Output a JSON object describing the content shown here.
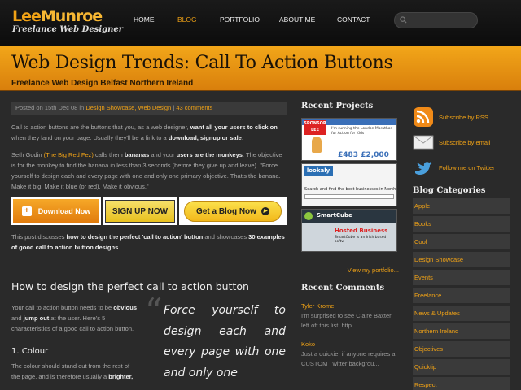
{
  "logo": {
    "name_a": "Lee",
    "name_b": "Munroe",
    "tagline": "Freelance Web Designer"
  },
  "nav": [
    "HOME",
    "BLOG",
    "PORTFOLIO",
    "ABOUT ME",
    "CONTACT"
  ],
  "nav_active": "BLOG",
  "search": {
    "placeholder": ""
  },
  "banner": {
    "title": "Web Design Trends: Call To Action Buttons",
    "subtitle": "Freelance Web Design Belfast Northern Ireland"
  },
  "post": {
    "meta": {
      "prefix": "Posted on 15th Dec 08 in ",
      "categories": "Design Showcase, Web Design",
      "separator": " | ",
      "comments": "43 comments"
    },
    "p1": {
      "a": "Call to action buttons are the buttons that you, as a web designer, ",
      "b": "want all your users to click on",
      "c": " when they land on your page. Usually they'll be a link to a ",
      "d": "download, signup or sale",
      "e": "."
    },
    "p2": {
      "a": "Seth Godin ",
      "link": "(The Big Red Fez)",
      "b": " calls them ",
      "c": "bananas",
      "d": " and your ",
      "e": "users are the monkeys",
      "f": ". The objective is for the monkey to find the banana in less than 3 seconds (before they give up and leave). \"Force yourself to design each and every page with one and only one primary objective. That's the banana. Make it big. Make it blue (or red). Make it obvious.\""
    },
    "cta": {
      "download": "Download Now",
      "signup": "SIGN UP NOW",
      "blog": "Get a Blog Now"
    },
    "p3": {
      "a": "This post discusses ",
      "b": "how to design the perfect 'call to action' button",
      "c": " and showcases ",
      "d": "30 examples of good call to action button designs",
      "e": "."
    },
    "h2": "How to design the perfect call to action button",
    "p4": {
      "a": "Your call to action button needs to be ",
      "b": "obvious",
      "c": " and ",
      "d": "jump out",
      "e": " at the user. Here's 5 characteristics of a good call to action button."
    },
    "h3": "1. Colour",
    "p5": {
      "a": "The colour should stand out from the rest of the page, and is therefore usually a ",
      "b": "brighter,"
    },
    "quote": "Force yourself to design each and every page with one and only one"
  },
  "projects": {
    "title": "Recent Projects",
    "thumb1": {
      "badge": "SPONSOR LEE",
      "text": "I'm running the London Marathon for Action for Kids",
      "amount": "£483 £2,000"
    },
    "thumb2": {
      "logo": "lookaly",
      "text": "Search and find the best businesses in Northern Ir"
    },
    "thumb3": {
      "logo": "SmartCube",
      "headline": "Hosted Business",
      "subline": "SmartCube is an Irish based softw"
    },
    "view_link": "View my portfolio..."
  },
  "comments": {
    "title": "Recent Comments",
    "items": [
      {
        "author": "Tyler Krome",
        "text": "I'm surprised to see Claire Baxter left off this list. http..."
      },
      {
        "author": "Koko",
        "text": "Just a quickie: if anyone requires a CUSTOM Twitter backgrou..."
      }
    ]
  },
  "subscribe": {
    "rss": "Subscribe by RSS",
    "email": "Subscribe by email",
    "twitter": "Follow me on Twitter"
  },
  "categories": {
    "title": "Blog Categories",
    "items": [
      "Apple",
      "Books",
      "Cool",
      "Design Showcase",
      "Events",
      "Freelance",
      "News & Updates",
      "Northern Ireland",
      "Objectives",
      "Quicktip",
      "Respect"
    ]
  },
  "colors": {
    "accent": "#f0a216",
    "banner_top": "#f2a619",
    "banner_bottom": "#d97f0c",
    "background": "#2a2a2a"
  }
}
